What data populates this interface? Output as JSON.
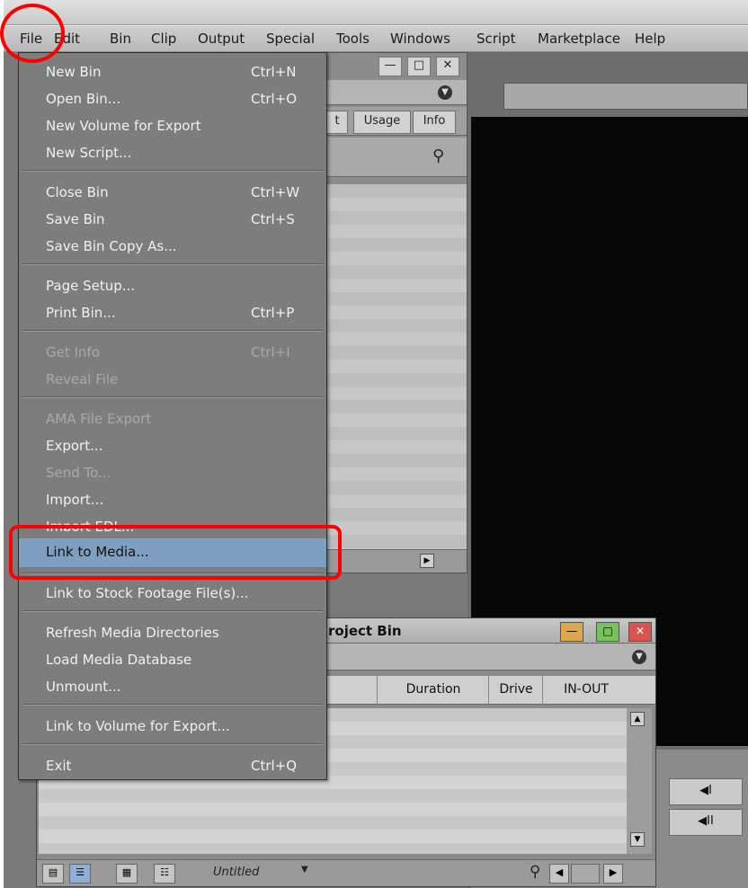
{
  "menubar": {
    "items": [
      "File",
      "Edit",
      "Bin",
      "Clip",
      "Output",
      "Special",
      "Tools",
      "Windows",
      "Script",
      "Marketplace",
      "Help"
    ]
  },
  "bin_window": {
    "tabs": [
      "t",
      "Usage",
      "Info"
    ]
  },
  "file_menu": {
    "items": [
      {
        "label": "New Bin",
        "shortcut": "Ctrl+N",
        "enabled": true
      },
      {
        "label": "Open Bin...",
        "shortcut": "Ctrl+O",
        "enabled": true
      },
      {
        "label": "New Volume for Export",
        "shortcut": "",
        "enabled": true
      },
      {
        "label": "New Script...",
        "shortcut": "",
        "enabled": true
      },
      {
        "label": "Close Bin",
        "shortcut": "Ctrl+W",
        "enabled": true
      },
      {
        "label": "Save Bin",
        "shortcut": "Ctrl+S",
        "enabled": true
      },
      {
        "label": "Save Bin Copy As...",
        "shortcut": "",
        "enabled": true
      },
      {
        "label": "Page Setup...",
        "shortcut": "",
        "enabled": true
      },
      {
        "label": "Print Bin...",
        "shortcut": "Ctrl+P",
        "enabled": true
      },
      {
        "label": "Get Info",
        "shortcut": "Ctrl+I",
        "enabled": false
      },
      {
        "label": "Reveal File",
        "shortcut": "",
        "enabled": false
      },
      {
        "label": "AMA File Export",
        "shortcut": "",
        "enabled": false
      },
      {
        "label": "Export...",
        "shortcut": "",
        "enabled": true
      },
      {
        "label": "Send To...",
        "shortcut": "",
        "enabled": false
      },
      {
        "label": "Import...",
        "shortcut": "",
        "enabled": true
      },
      {
        "label": "Import EDL...",
        "shortcut": "",
        "enabled": true
      },
      {
        "label": "Link to Media...",
        "shortcut": "",
        "enabled": true,
        "highlighted": true
      },
      {
        "label": "Link to Stock Footage File(s)...",
        "shortcut": "",
        "enabled": true
      },
      {
        "label": "Refresh Media Directories",
        "shortcut": "",
        "enabled": true
      },
      {
        "label": "Load Media Database",
        "shortcut": "",
        "enabled": true
      },
      {
        "label": "Unmount...",
        "shortcut": "",
        "enabled": true
      },
      {
        "label": "Link to Volume for Export...",
        "shortcut": "",
        "enabled": true
      },
      {
        "label": "Exit",
        "shortcut": "Ctrl+Q",
        "enabled": true
      }
    ]
  },
  "project_bin": {
    "title": "roject Bin",
    "columns": [
      "Duration",
      "Drive",
      "IN-OUT"
    ],
    "view_name": "Untitled"
  },
  "monitor": {
    "buttons": [
      "◀I",
      "◀II"
    ]
  },
  "colors": {
    "menu_bg": "#7d7d7d",
    "menu_highlight": "#7f9fc1",
    "annotation": "#ff0000"
  }
}
